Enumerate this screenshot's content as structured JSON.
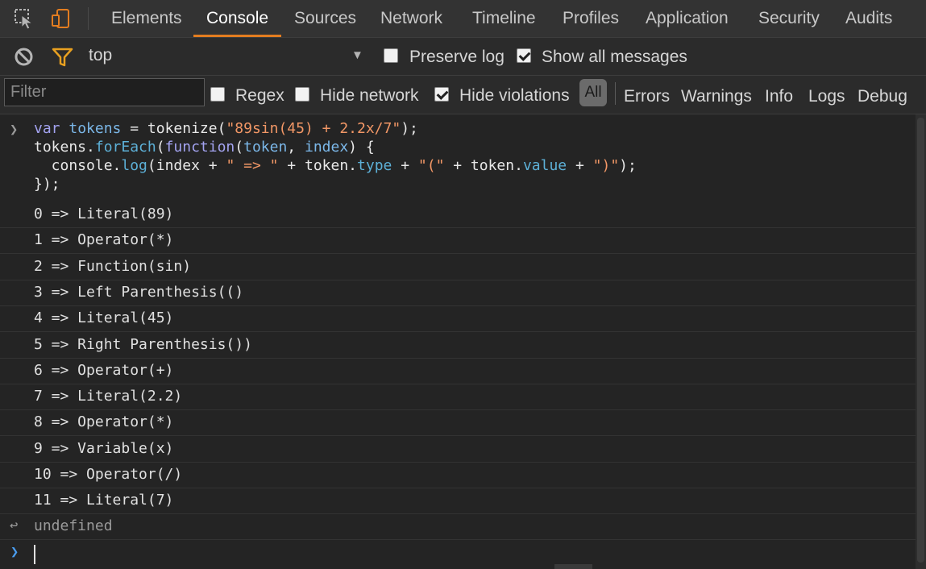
{
  "tabbar": {
    "tabs": [
      {
        "label": "Elements"
      },
      {
        "label": "Console"
      },
      {
        "label": "Sources"
      },
      {
        "label": "Network"
      },
      {
        "label": "Timeline"
      },
      {
        "label": "Profiles"
      },
      {
        "label": "Application"
      },
      {
        "label": "Security"
      },
      {
        "label": "Audits"
      }
    ],
    "active_tab": "Console"
  },
  "toolbar": {
    "context": "top",
    "preserve_log": {
      "label": "Preserve log",
      "checked": false
    },
    "show_all_messages": {
      "label": "Show all messages",
      "checked": true
    }
  },
  "filterbar": {
    "filter_placeholder": "Filter",
    "regex": {
      "label": "Regex",
      "checked": false
    },
    "hide_network": {
      "label": "Hide network",
      "checked": false
    },
    "hide_violations": {
      "label": "Hide violations",
      "checked": true
    },
    "levels": [
      "All",
      "Errors",
      "Warnings",
      "Info",
      "Logs",
      "Debug"
    ]
  },
  "console": {
    "input_code": [
      "var tokens = tokenize(\"89sin(45) + 2.2x/7\");",
      "tokens.forEach(function(token, index) {",
      "  console.log(index + \" => \" + token.type + \"(\" + token.value + \")\");",
      "});"
    ],
    "log_lines": [
      "0 => Literal(89)",
      "1 => Operator(*)",
      "2 => Function(sin)",
      "3 => Left Parenthesis(()",
      "4 => Literal(45)",
      "5 => Right Parenthesis())",
      "6 => Operator(+)",
      "7 => Literal(2.2)",
      "8 => Operator(*)",
      "9 => Variable(x)",
      "10 => Operator(/)",
      "11 => Literal(7)"
    ],
    "result": "undefined"
  },
  "colors": {
    "accent": "#e37d20",
    "keyword": "#a3a3f0",
    "string": "#f29766",
    "variable": "#7bb7e8",
    "prompt": "#4a9df0"
  }
}
